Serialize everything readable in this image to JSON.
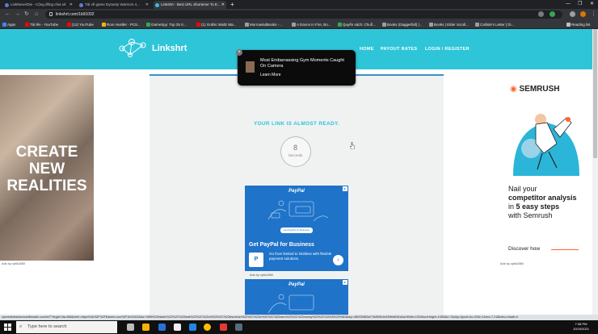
{
  "browser": {
    "tabs": [
      {
        "label": "LinkNeverDie - Cộng đồng chia sẻ",
        "color": "#5e7bd6"
      },
      {
        "label": "Tải về game Dynasty Warriors 4...",
        "color": "#5e7bd6"
      },
      {
        "label": "Linkshrt - Best URL Shortener To E...",
        "color": "#2ec5d8"
      }
    ],
    "url": "linkshrt.com/1b91002",
    "bookmarks": [
      {
        "label": "Apps",
        "color": "#4285f4"
      },
      {
        "label": "Tải lên - YouTube",
        "color": "#ff0000"
      },
      {
        "label": "(12) YouTube",
        "color": "#ff0000"
      },
      {
        "label": "Rom Hustler - PC8...",
        "color": "#f4b400"
      },
      {
        "label": "GameSpy: Top 25 Ir...",
        "color": "#34a853"
      },
      {
        "label": "(1) Gothic Waltz Ma...",
        "color": "#ff0000"
      },
      {
        "label": "MorrowindBooks -...",
        "color": "#9e9e9e"
      },
      {
        "label": "A Dance in Fire, Bo...",
        "color": "#9e9e9e"
      },
      {
        "label": "Quyển sách: Chuỗ...",
        "color": "#34a853"
      },
      {
        "label": "Books (Daggerfall) |...",
        "color": "#9e9e9e"
      },
      {
        "label": "Books | Elder Scroll...",
        "color": "#9e9e9e"
      },
      {
        "label": "Calliste's Letter | Di...",
        "color": "#9e9e9e"
      }
    ],
    "reading_list": "Reading list",
    "status_url": "openedinfrastructurelitewaite.com/rel7?rfcgfa?ufa=666&refer=https%3A%2F%2Flinkshrt.com%2F1b91002&kw=%5B%22linkshrt%22%2C%22best%22%2C%22url%22%2C%22shortener%22%2C%22to%22%2C%22earn%22%2C%22money%22%2C%2018%22%5D&key=469230863a778d9061fcf159fe6f040&scrWidth=1920&scrHeight=1080&tz=7&skip=&psid=&v=20&t=1&res=7.218&dev=r&adb=n"
  },
  "site": {
    "logo": "Linkshrt",
    "nav": [
      "HOME",
      "PAYOUT RATES",
      "LOGIN / REGISTER"
    ],
    "ready_text": "YOUR LINK IS ALMOST READY.",
    "timer_value": "8",
    "timer_label": "Seconds"
  },
  "popup_ad": {
    "title": "Most Embarrassing Gym Moments Caught On Camera",
    "link": "Learn More"
  },
  "paypal_ad": {
    "brand": "PayPal",
    "button": "Get PayPal for Business",
    "headline": "Get PayPal for Business",
    "sub": "Go from limited to limitless with flexible payment solutions",
    "icon": "P",
    "ads_by": "Ads by optAd360"
  },
  "paypal_ad_2": {
    "brand": "PayPal"
  },
  "left_ad": {
    "text": "CREATE NEW REALITIES",
    "ads_by": "Ads by optAd360"
  },
  "right_ad": {
    "brand": "SEMRUSH",
    "line1": "Nail your",
    "line2_bold": "competitor analysis",
    "line3": "in",
    "line4_bold": "5 easy steps",
    "line5": "with Semrush",
    "cta": "Discover how",
    "ads_by": "Ads by optAd360"
  },
  "taskbar": {
    "search_placeholder": "Type here to search",
    "time": "7:38 PM",
    "date": "10/16/2021"
  },
  "colors": {
    "brand_teal": "#2ec5d8",
    "paypal_blue": "#1f73c9",
    "semrush_orange": "#ff642d"
  }
}
